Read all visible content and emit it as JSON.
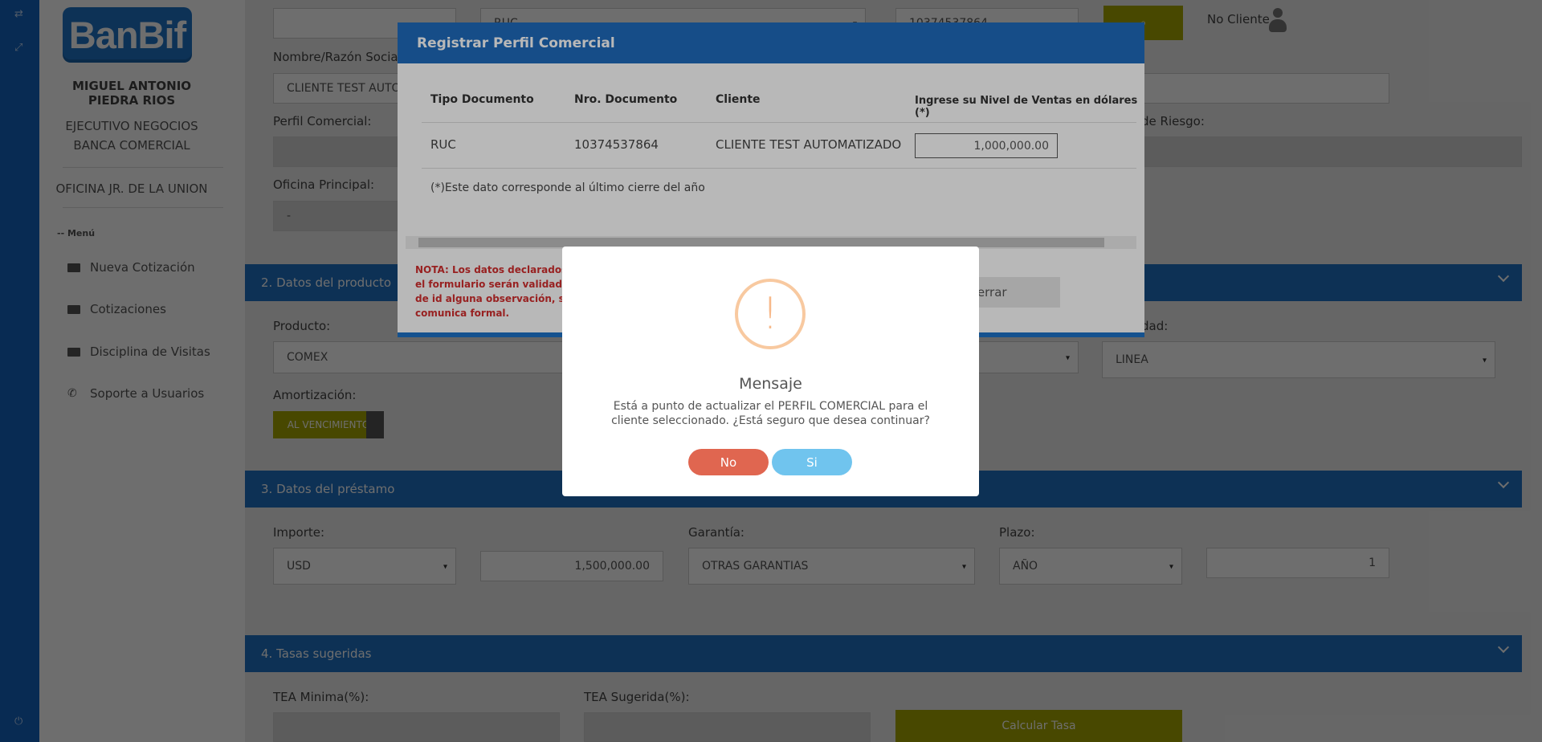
{
  "brand": {
    "logo_text": "BanBif"
  },
  "sidebar": {
    "user_name": "MIGUEL ANTONIO PIEDRA RIOS",
    "user_role": "EJECUTIVO NEGOCIOS BANCA COMERCIAL",
    "office": "OFICINA JR. DE LA UNION",
    "menu_label": "-- Menú",
    "items": [
      {
        "label": "Nueva Cotización",
        "icon": "id-card-icon"
      },
      {
        "label": "Cotizaciones",
        "icon": "id-card-icon"
      },
      {
        "label": "Disciplina de Visitas",
        "icon": "id-card-icon"
      },
      {
        "label": "Soporte a Usuarios",
        "icon": "phone-icon"
      }
    ]
  },
  "client": {
    "doc_type": "RUC",
    "doc_number": "10374537864",
    "no_cliente": "No Cliente",
    "name_label": "Nombre/Razón Social",
    "name_value": "CLIENTE TEST AUTO",
    "perfil_label": "Perfil Comercial:",
    "riesgo_label": "de Riesgo:",
    "oficina_label": "Oficina Principal:",
    "oficina_value": "-"
  },
  "section2": {
    "title": "2. Datos del producto",
    "producto_label": "Producto:",
    "producto_value": "COMEX",
    "modalidad_label": "dad:",
    "modalidad_value": "LINEA",
    "amortizacion_label": "Amortización:",
    "amortizacion_value": "AL VENCIMIENTO"
  },
  "section3": {
    "title": "3. Datos del préstamo",
    "importe_label": "Importe:",
    "currency": "USD",
    "amount": "1,500,000.00",
    "garantia_label": "Garantía:",
    "garantia_value": "OTRAS GARANTIAS",
    "plazo_label": "Plazo:",
    "plazo_unit": "AÑO",
    "plazo_value": "1"
  },
  "section4": {
    "title": "4. Tasas sugeridas",
    "tea_min_label": "TEA Minima(%):",
    "tea_sug_label": "TEA Sugerida(%):",
    "calc_button": "Calcular Tasa"
  },
  "modal": {
    "title": "Registrar Perfil Comercial",
    "headers": [
      "Tipo Documento",
      "Nro. Documento",
      "Cliente",
      "Ingrese su Nivel de Ventas en dólares (*)"
    ],
    "row": {
      "tipo": "RUC",
      "nro": "10374537864",
      "cliente": "CLIENTE TEST AUTOMATIZADO",
      "ventas": "1,000,000.00"
    },
    "footnote": "(*)Este dato corresponde al último cierre del año",
    "nota": "NOTA: Los datos declarados en el formulario serán validados; de id alguna observación, se comunica formal.",
    "close_button": "Cerrar"
  },
  "dialog": {
    "icon": "!",
    "title": "Mensaje",
    "text": "Está a punto de actualizar el PERFIL COMERCIAL para el cliente seleccionado. ¿Está seguro que desea continuar?",
    "no_button": "No",
    "yes_button": "Si"
  },
  "colors": {
    "primary": "#1e72c6",
    "olive": "#a8a800",
    "no": "#e06650",
    "yes": "#70c4ee",
    "warning": "#f8c9a0",
    "nota": "#d32f2f"
  }
}
